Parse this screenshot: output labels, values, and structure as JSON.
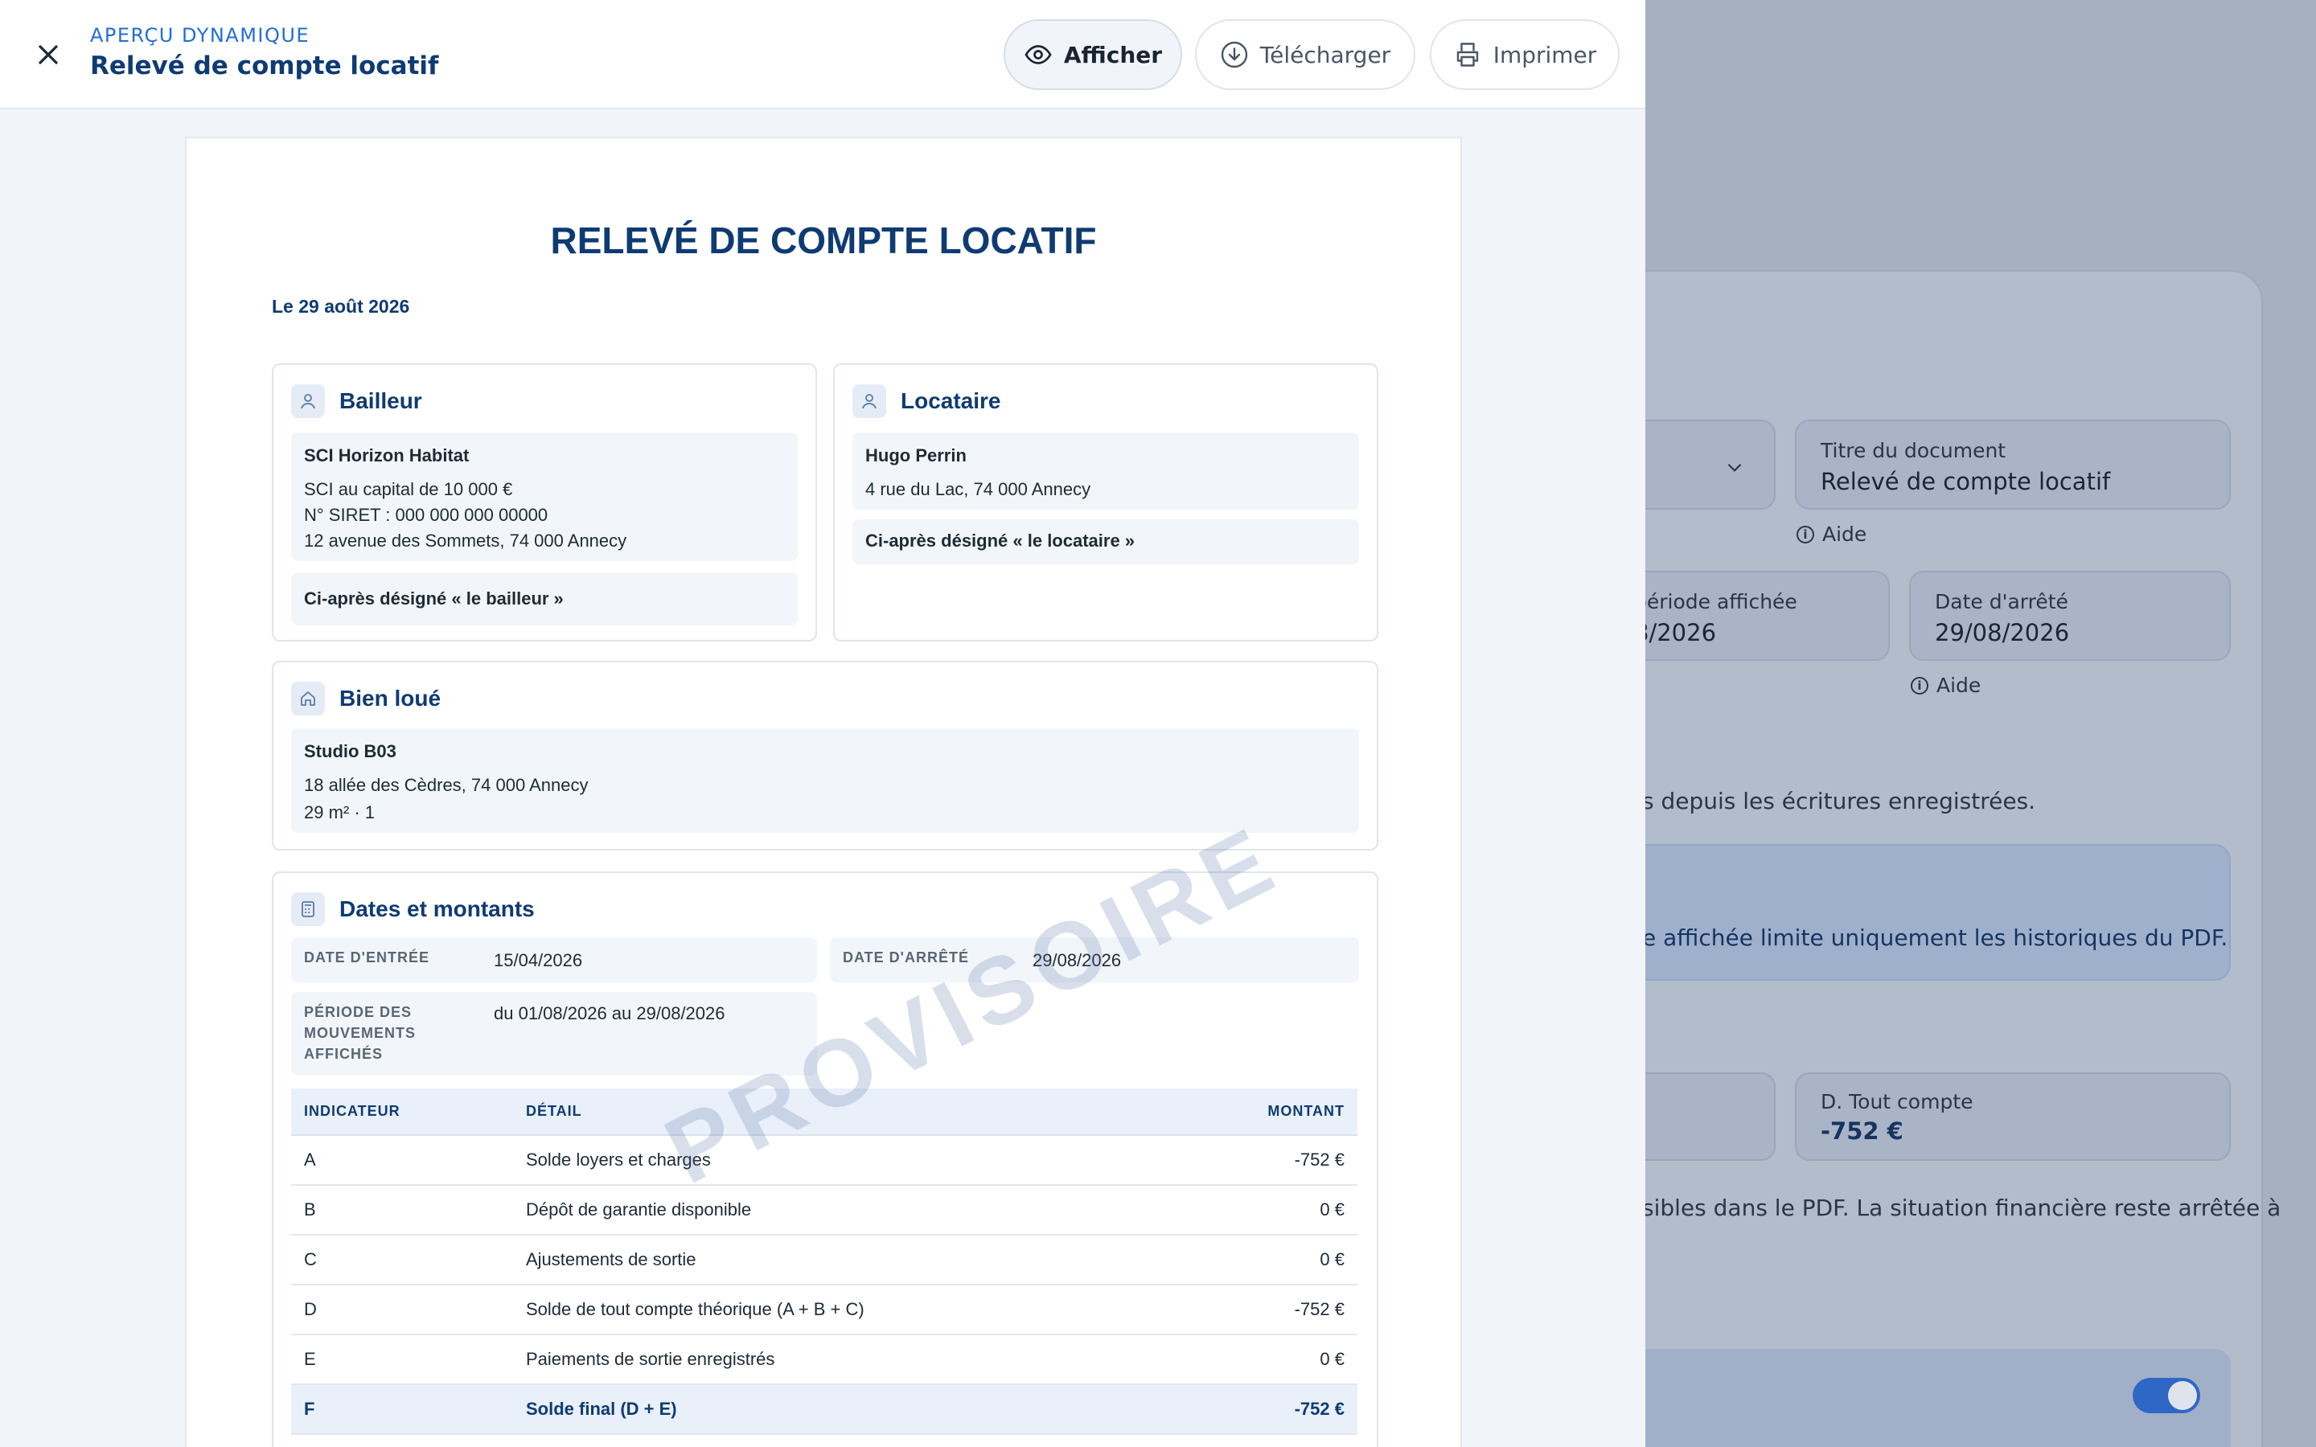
{
  "modal": {
    "kicker": "APERÇU DYNAMIQUE",
    "title": "Relevé de compte locatif",
    "buttons": {
      "show": "Afficher",
      "download": "Télécharger",
      "print": "Imprimer"
    }
  },
  "document": {
    "title": "RELEVÉ DE COMPTE LOCATIF",
    "date": "Le 29 août 2026",
    "watermark": "PROVISOIRE",
    "landlord": {
      "heading": "Bailleur",
      "name": "SCI Horizon Habitat",
      "capital": "SCI au capital de 10 000 €",
      "siret": "N° SIRET : 000 000 000 00000",
      "address": "12 avenue des Sommets, 74 000 Annecy",
      "designation": "Ci-après désigné « le bailleur »"
    },
    "tenant": {
      "heading": "Locataire",
      "name": "Hugo Perrin",
      "address": "4 rue du Lac, 74 000 Annecy",
      "designation": "Ci-après désigné « le locataire »"
    },
    "property": {
      "heading": "Bien loué",
      "name": "Studio B03",
      "address": "18 allée des Cèdres, 74 000 Annecy",
      "details": "29 m² · 1"
    },
    "dates": {
      "heading": "Dates et montants",
      "entry_label": "DATE D'ENTRÉE",
      "entry_value": "15/04/2026",
      "stop_label": "DATE D'ARRÊTÉ",
      "stop_value": "29/08/2026",
      "period_label_1": "PÉRIODE DES",
      "period_label_2": "MOUVEMENTS",
      "period_label_3": "AFFICHÉS",
      "period_value": "du 01/08/2026 au 29/08/2026"
    },
    "table": {
      "headers": [
        "INDICATEUR",
        "DÉTAIL",
        "MONTANT"
      ],
      "rows": [
        [
          "A",
          "Solde loyers et charges",
          "-752 €"
        ],
        [
          "B",
          "Dépôt de garantie disponible",
          "0 €"
        ],
        [
          "C",
          "Ajustements de sortie",
          "0 €"
        ],
        [
          "D",
          "Solde de tout compte théorique (A + B + C)",
          "-752 €"
        ],
        [
          "E",
          "Paiements de sortie enregistrés",
          "0 €"
        ],
        [
          "F",
          "Solde final (D + E)",
          "-752 €"
        ]
      ]
    }
  },
  "background": {
    "doc_title_label": "Titre du document",
    "doc_title_value": "Relevé de compte locatif",
    "help": "Aide",
    "period_label": "période affichée",
    "period_value": "8/2026",
    "stop_label": "Date d'arrêté",
    "stop_value": "29/08/2026",
    "help2": "Aide",
    "note1": "s depuis les écritures enregistrées.",
    "info": "e affichée limite uniquement les historiques du PDF.",
    "total_label": "D. Tout compte",
    "total_value": "-752 €",
    "note2": "sibles dans le PDF. La situation financière reste arrêtée à"
  },
  "colors": {
    "accent": "#1f6fd6",
    "navy": "#0f3b73",
    "toggle": "#2f67c6"
  }
}
